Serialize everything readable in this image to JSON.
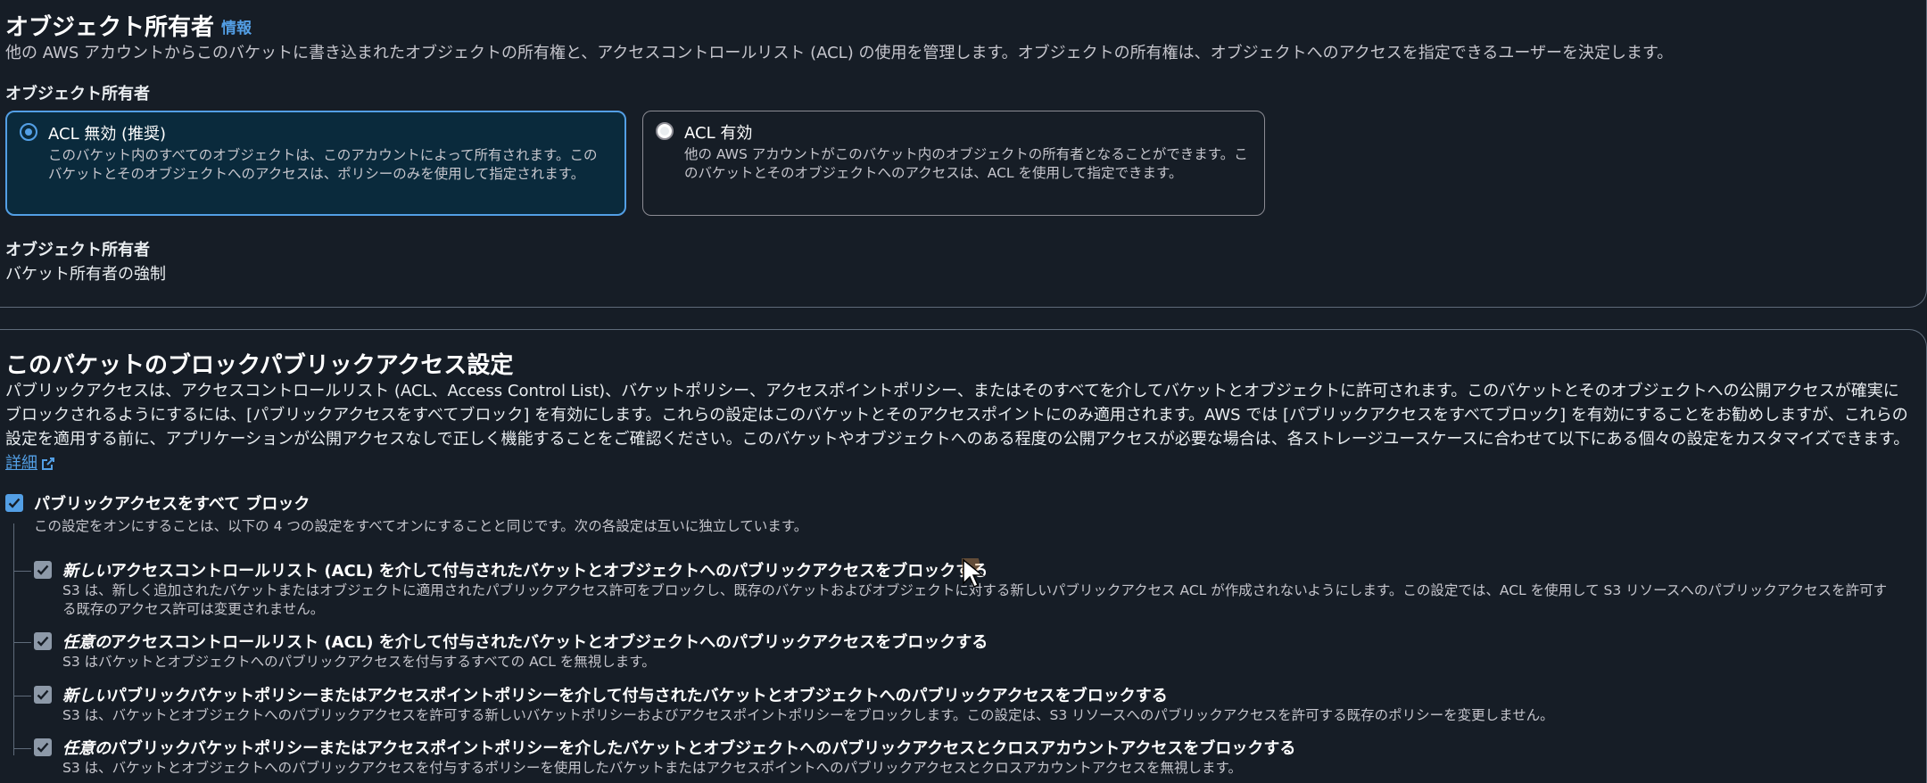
{
  "ownership": {
    "title": "オブジェクト所有者",
    "info": "情報",
    "description": "他の AWS アカウントからこのバケットに書き込まれたオブジェクトの所有権と、アクセスコントロールリスト (ACL) の使用を管理します。オブジェクトの所有権は、オブジェクトへのアクセスを指定できるユーザーを決定します。",
    "field_label": "オブジェクト所有者",
    "options": [
      {
        "title": "ACL 無効 (推奨)",
        "description": "このバケット内のすべてのオブジェクトは、このアカウントによって所有されます。このバケットとそのオブジェクトへのアクセスは、ポリシーのみを使用して指定されます。",
        "selected": true
      },
      {
        "title": "ACL 有効",
        "description": "他の AWS アカウントがこのバケット内のオブジェクトの所有者となることができます。このバケットとそのオブジェクトへのアクセスは、ACL を使用して指定できます。",
        "selected": false
      }
    ],
    "owner_label": "オブジェクト所有者",
    "owner_value": "バケット所有者の強制"
  },
  "block_public": {
    "title": "このバケットのブロックパブリックアクセス設定",
    "description": "パブリックアクセスは、アクセスコントロールリスト (ACL、Access Control List)、バケットポリシー、アクセスポイントポリシー、またはそのすべてを介してバケットとオブジェクトに許可されます。このバケットとそのオブジェクトへの公開アクセスが確実にブロックされるようにするには、[パブリックアクセスをすべてブロック] を有効にします。これらの設定はこのバケットとそのアクセスポイントにのみ適用されます。AWS では [パブリックアクセスをすべてブロック] を有効にすることをお勧めしますが、これらの設定を適用する前に、アプリケーションが公開アクセスなしで正しく機能することをご確認ください。このバケットやオブジェクトへのある程度の公開アクセスが必要な場合は、各ストレージユースケースに合わせて以下にある個々の設定をカスタマイズできます。",
    "detail_link": "詳細",
    "block_all": {
      "label": "パブリックアクセスをすべて ブロック",
      "description": "この設定をオンにすることは、以下の 4 つの設定をすべてオンにすることと同じです。次の各設定は互いに独立しています。",
      "checked": true
    },
    "settings": [
      {
        "title_em": "新しい",
        "title_rest": "アクセスコントロールリスト (ACL) を介して付与されたバケットとオブジェクトへのパブリックアクセスをブロックする",
        "description": "S3 は、新しく追加されたバケットまたはオブジェクトに適用されたパブリックアクセス許可をブロックし、既存のバケットおよびオブジェクトに対する新しいパブリックアクセス ACL が作成されないようにします。この設定では、ACL を使用して S3 リソースへのパブリックアクセスを許可する既存のアクセス許可は変更されません。",
        "checked": true
      },
      {
        "title_em": "任意の",
        "title_rest": "アクセスコントロールリスト (ACL) を介して付与されたバケットとオブジェクトへのパブリックアクセスをブロックする",
        "description": "S3 はバケットとオブジェクトへのパブリックアクセスを付与するすべての ACL を無視します。",
        "checked": true
      },
      {
        "title_em": "新しい",
        "title_rest": "パブリックバケットポリシーまたはアクセスポイントポリシーを介して付与されたバケットとオブジェクトへのパブリックアクセスをブロックする",
        "description": "S3 は、バケットとオブジェクトへのパブリックアクセスを許可する新しいバケットポリシーおよびアクセスポイントポリシーをブロックします。この設定は、S3 リソースへのパブリックアクセスを許可する既存のポリシーを変更しません。",
        "checked": true
      },
      {
        "title_em": "任意の",
        "title_rest": "パブリックバケットポリシーまたはアクセスポイントポリシーを介したバケットとオブジェクトへのパブリックアクセスとクロスアカウントアクセスをブロックする",
        "description": "S3 は、バケットとオブジェクトへのパブリックアクセスを付与するポリシーを使用したバケットまたはアクセスポイントへのパブリックアクセスとクロスアカウントアクセスを無視します。",
        "checked": true
      }
    ]
  },
  "colors": {
    "background": "#161d26",
    "accent": "#539fe5",
    "selected_tile": "#0a2a3c",
    "disabled_checkbox": "#8d99a8"
  }
}
